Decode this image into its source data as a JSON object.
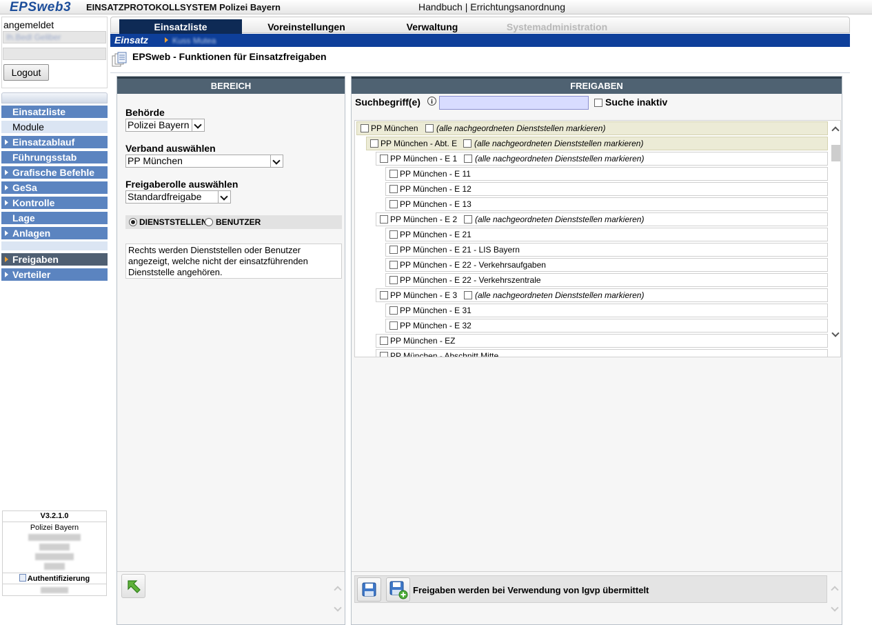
{
  "header": {
    "logo": "EPSweb3",
    "app_title": "EINSATZPROTOKOLLSYSTEM Polizei Bayern",
    "link_handbuch": "Handbuch",
    "separator": "|",
    "link_errichtung": "Errichtungsanordnung"
  },
  "login": {
    "label": "angemeldet",
    "user": "Ih.Bedl Geliber",
    "logout": "Logout"
  },
  "nav": {
    "items": [
      {
        "label": "Einsatzliste",
        "type": "main"
      },
      {
        "label": "Module",
        "type": "sub"
      },
      {
        "label": "Einsatzablauf",
        "type": "arrow"
      },
      {
        "label": "Führungsstab",
        "type": "main"
      },
      {
        "label": "Grafische Befehle",
        "type": "arrow"
      },
      {
        "label": "GeSa",
        "type": "arrow"
      },
      {
        "label": "Kontrolle",
        "type": "arrow"
      },
      {
        "label": "Lage",
        "type": "main"
      },
      {
        "label": "Anlagen",
        "type": "arrow"
      }
    ],
    "items2": [
      {
        "label": "Freigaben",
        "type": "active"
      },
      {
        "label": "Verteiler",
        "type": "arrow"
      }
    ]
  },
  "info": {
    "version": "V3.2.1.0",
    "org": "Polizei Bayern",
    "auth": "Authentifizierung"
  },
  "tabs": {
    "einsatzliste": "Einsatzliste",
    "voreinstellungen": "Voreinstellungen",
    "verwaltung": "Verwaltung",
    "systemadmin": "Systemadministration"
  },
  "breadcrumb": {
    "root": "Einsatz",
    "current": "Kuss Mutea"
  },
  "page": {
    "title": "EPSweb - Funktionen für Einsatzfreigaben"
  },
  "bereich": {
    "header": "BEREICH",
    "behoerde_label": "Behörde",
    "behoerde_value": "Polizei Bayern",
    "verband_label": "Verband auswählen",
    "verband_value": "PP München",
    "rolle_label": "Freigaberolle auswählen",
    "rolle_value": "Standardfreigabe",
    "radio_dienststellen": "DIENSTSTELLEN",
    "radio_benutzer": "BENUTZER",
    "radio_selected": "DIENSTSTELLEN",
    "hint": "Rechts werden Dienststellen oder Benutzer angezeigt, welche nicht der einsatzführenden Dienststelle angehören."
  },
  "freigaben": {
    "header": "FREIGABEN",
    "search_label": "Suchbegriff(e)",
    "search_value": "",
    "suche_inaktiv": "Suche inaktiv",
    "all_label": "(alle nachgeordneten Dienststellen markieren)",
    "tree": [
      {
        "name": "PP München",
        "level": 0,
        "all": true,
        "hl": true
      },
      {
        "name": "PP München - Abt. E",
        "level": 1,
        "all": true,
        "hl": true
      },
      {
        "name": "PP München - E 1",
        "level": 2,
        "all": true
      },
      {
        "name": "PP München - E 11",
        "level": 3
      },
      {
        "name": "PP München - E 12",
        "level": 3
      },
      {
        "name": "PP München - E 13",
        "level": 3
      },
      {
        "name": "PP München - E 2",
        "level": 2,
        "all": true
      },
      {
        "name": "PP München - E 21",
        "level": 3
      },
      {
        "name": "PP München - E 21 - LIS Bayern",
        "level": 3
      },
      {
        "name": "PP München - E 22 - Verkehrsaufgaben",
        "level": 3
      },
      {
        "name": "PP München - E 22 - Verkehrszentrale",
        "level": 3
      },
      {
        "name": "PP München - E 3",
        "level": 2,
        "all": true
      },
      {
        "name": "PP München - E 31",
        "level": 3
      },
      {
        "name": "PP München - E 32",
        "level": 3
      },
      {
        "name": "PP München - EZ",
        "level": 2
      },
      {
        "name": "PP München - Abschnitt Mitte",
        "level": 2
      }
    ],
    "save_text": "Freigaben werden bei Verwendung von Igvp übermittelt"
  },
  "colors": {
    "nav_blue": "#5b84c0",
    "nav_active": "#4f5f72",
    "tab_active": "#0e2a55",
    "crumb_blue": "#0e3f9a",
    "panel_head": "#4f6272",
    "search_bg": "#d8dcff"
  }
}
